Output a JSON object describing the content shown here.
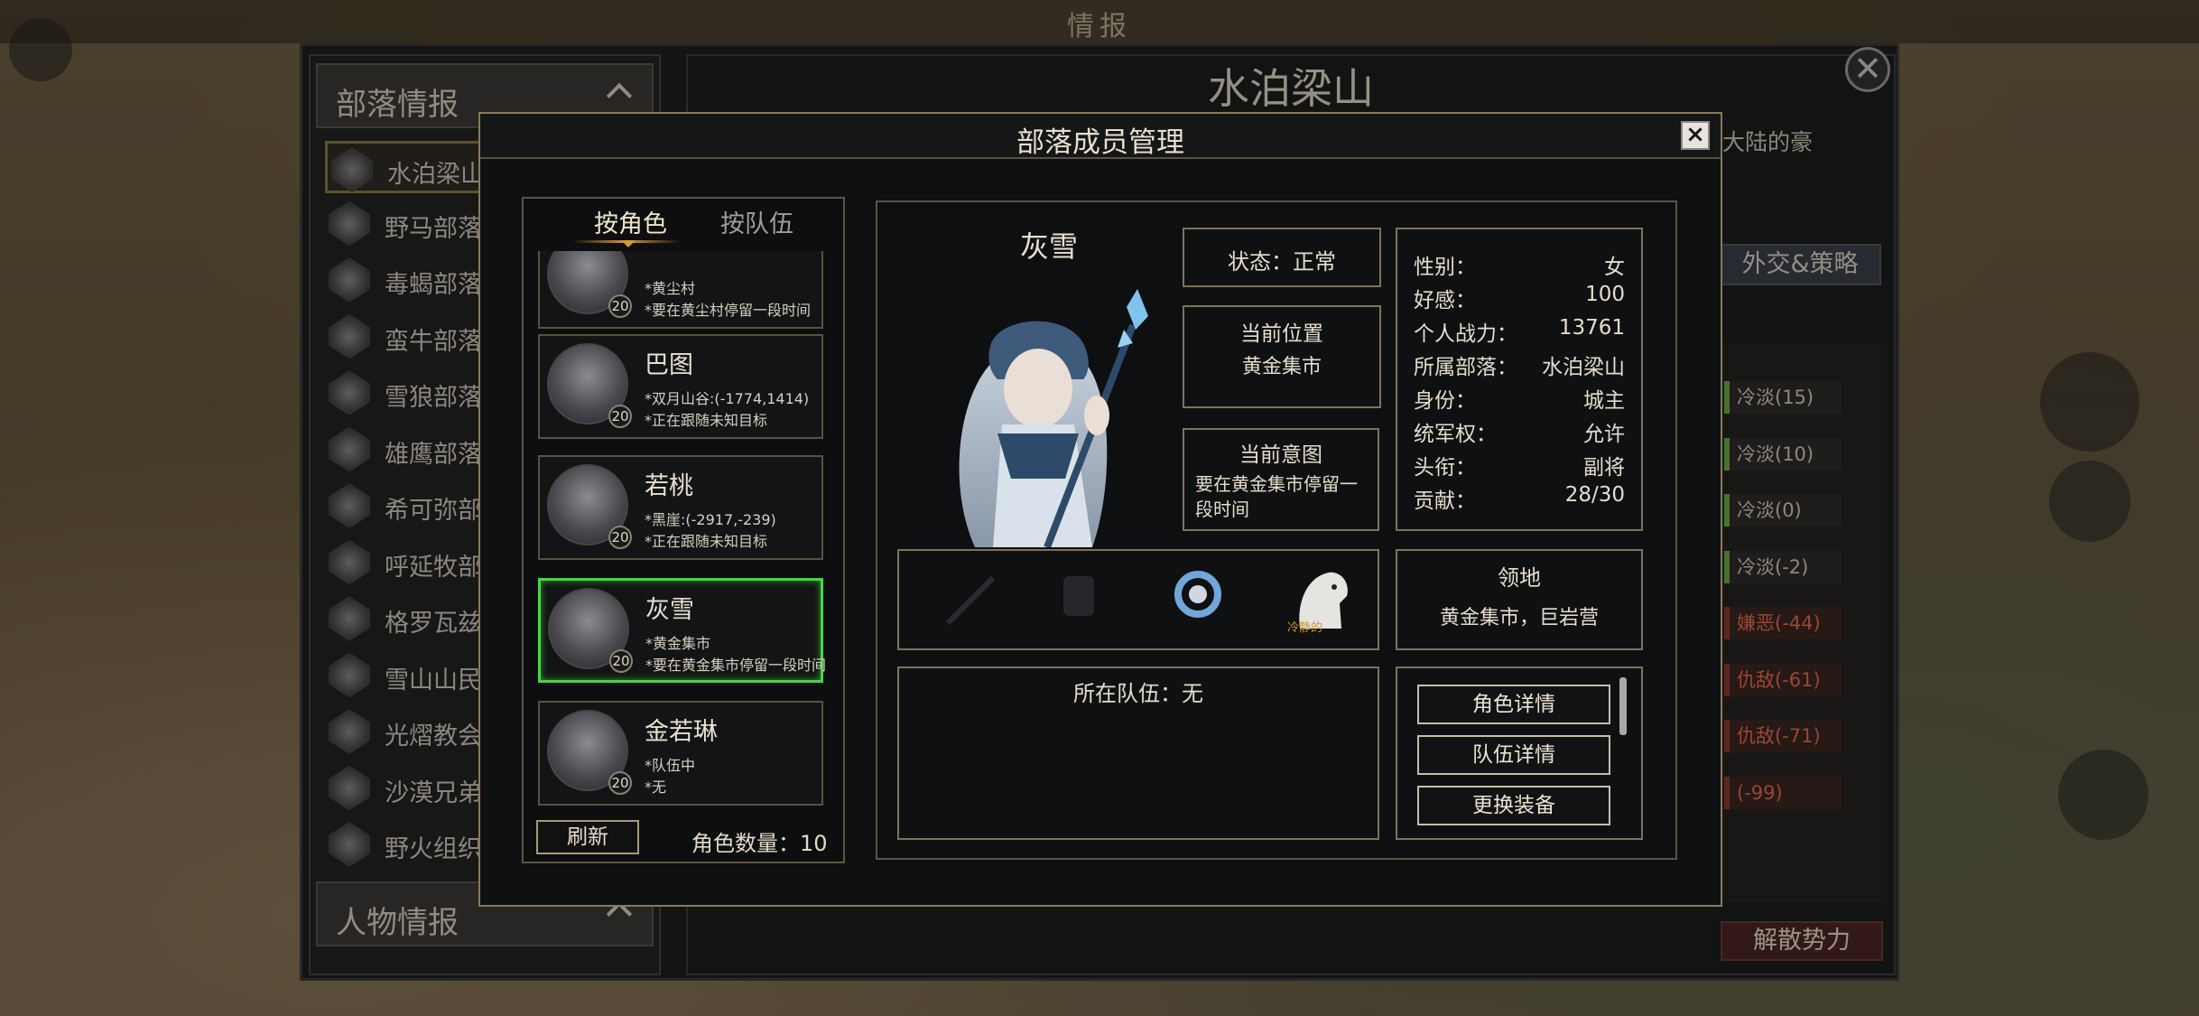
{
  "top_title": "情报",
  "left_panel": {
    "section_tribes": "部落情报",
    "tribes": [
      "水泊梁山",
      "野马部落",
      "毒蝎部落",
      "蛮牛部落",
      "雪狼部落",
      "雄鹰部落",
      "希可弥部",
      "呼延牧部",
      "格罗瓦兹部",
      "雪山山民",
      "光熠教会",
      "沙漠兄弟",
      "野火组织"
    ],
    "section_people": "人物情报"
  },
  "right_panel": {
    "title": "水泊梁山",
    "subtitle": "大陆的豪",
    "diplomacy_tab": "外交&策略",
    "relations": [
      "冷淡(15)",
      "冷淡(10)",
      "冷淡(0)",
      "冷淡(-2)",
      "嫌恶(-44)",
      "仇敌(-61)",
      "仇敌(-71)",
      "(-99)"
    ],
    "disband_button": "解散势力"
  },
  "dialog": {
    "title": "部落成员管理",
    "tabs": {
      "by_role": "按角色",
      "by_team": "按队伍"
    },
    "members": [
      {
        "name": "",
        "level": "20",
        "line1": "*黄尘村",
        "line2": "*要在黄尘村停留一段时间"
      },
      {
        "name": "巴图",
        "level": "20",
        "line1": "*双月山谷:(-1774,1414)",
        "line2": "*正在跟随未知目标"
      },
      {
        "name": "若桃",
        "level": "20",
        "line1": "*黑崖:(-2917,-239)",
        "line2": "*正在跟随未知目标"
      },
      {
        "name": "灰雪",
        "level": "20",
        "line1": "*黄金集市",
        "line2": "*要在黄金集市停留一段时间",
        "selected": true
      },
      {
        "name": "金若琳",
        "level": "20",
        "line1": "*队伍中",
        "line2": "*无"
      }
    ],
    "refresh_button": "刷新",
    "count_label": "角色数量：10",
    "detail": {
      "name": "灰雪",
      "status": "状态：正常",
      "location_title": "当前位置",
      "location_value": "黄金集市",
      "intent_title": "当前意图",
      "intent_value_1": "要在黄金集市停留一",
      "intent_value_2": "段时间",
      "attributes": [
        {
          "k": "性别：",
          "v": "女"
        },
        {
          "k": "好感：",
          "v": "100"
        },
        {
          "k": "个人战力：",
          "v": "13761"
        },
        {
          "k": "所属部落：",
          "v": "水泊梁山"
        },
        {
          "k": "身份：",
          "v": "城主"
        },
        {
          "k": "统军权：",
          "v": "允许"
        },
        {
          "k": "头衔：",
          "v": "副将"
        },
        {
          "k": "贡献：",
          "v": "28/30"
        }
      ],
      "equipment_captions": [
        "",
        "冷静的"
      ],
      "territory_title": "领地",
      "territory_value": "黄金集市，巨岩营",
      "team_label": "所在队伍：无",
      "actions": [
        "角色详情",
        "队伍详情",
        "更换装备"
      ]
    }
  },
  "colors": {
    "selected_border": "#4fcf4a",
    "frame_gold": "#7e7258",
    "accent_orange": "#d39a3c"
  }
}
